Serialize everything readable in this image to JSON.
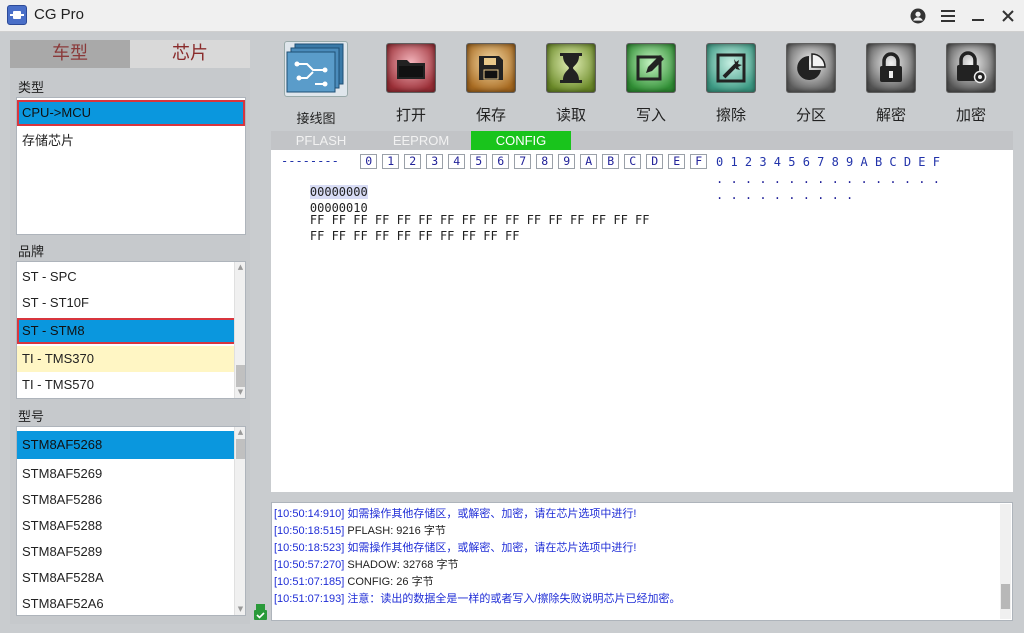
{
  "window": {
    "title": "CG Pro"
  },
  "left_panel": {
    "tabs": [
      {
        "label": "车型",
        "active": false
      },
      {
        "label": "芯片",
        "active": true
      }
    ],
    "type_section": {
      "label": "类型",
      "items": [
        {
          "label": "CPU->MCU",
          "selected": true
        },
        {
          "label": "存储芯片",
          "selected": false
        }
      ]
    },
    "brand_section": {
      "label": "品牌",
      "items": [
        {
          "label": "ST - SPC",
          "selected": false
        },
        {
          "label": "ST - ST10F",
          "selected": false
        },
        {
          "label": "ST - STM8",
          "selected": true
        },
        {
          "label": "TI - TMS370",
          "selected": false
        },
        {
          "label": "TI - TMS570",
          "selected": false
        }
      ]
    },
    "model_section": {
      "label": "型号",
      "items": [
        {
          "label": "STM8AF5268",
          "selected": true
        },
        {
          "label": "STM8AF5269",
          "selected": false
        },
        {
          "label": "STM8AF5286",
          "selected": false
        },
        {
          "label": "STM8AF5288",
          "selected": false
        },
        {
          "label": "STM8AF5289",
          "selected": false
        },
        {
          "label": "STM8AF528A",
          "selected": false
        },
        {
          "label": "STM8AF52A6",
          "selected": false
        }
      ]
    }
  },
  "toolbar": {
    "buttons": [
      {
        "label": "接线图",
        "icon": "wiring-diagram-icon",
        "color": "#3a7aa8"
      },
      {
        "label": "打开",
        "icon": "folder-icon",
        "color": "#a0353c"
      },
      {
        "label": "保存",
        "icon": "floppy-icon",
        "color": "#b87a28"
      },
      {
        "label": "读取",
        "icon": "hourglass-icon",
        "color": "#6e8a2c"
      },
      {
        "label": "写入",
        "icon": "edit-icon",
        "color": "#3d9a3b"
      },
      {
        "label": "擦除",
        "icon": "erase-icon",
        "color": "#4aa08a"
      },
      {
        "label": "分区",
        "icon": "pie-icon",
        "color": "#6a6a6a"
      },
      {
        "label": "解密",
        "icon": "unlock-icon",
        "color": "#5a5a5a"
      },
      {
        "label": "加密",
        "icon": "lock-gear-icon",
        "color": "#5a5a5a"
      }
    ]
  },
  "hex_editor": {
    "tabs": [
      {
        "label": "PFLASH",
        "active": false
      },
      {
        "label": "EEPROM",
        "active": false
      },
      {
        "label": "CONFIG",
        "active": true
      }
    ],
    "address_header": "--------",
    "columns": [
      "0",
      "1",
      "2",
      "3",
      "4",
      "5",
      "6",
      "7",
      "8",
      "9",
      "A",
      "B",
      "C",
      "D",
      "E",
      "F"
    ],
    "ascii_header": "0 1 2 3 4 5 6 7 8 9 A B C D E F",
    "rows": [
      {
        "address": "00000000",
        "bytes": "FF FF FF FF FF FF FF FF FF FF FF FF FF FF FF FF",
        "ascii": ". . . . . . . . . . . . . . . ."
      },
      {
        "address": "00000010",
        "bytes": "FF FF FF FF FF FF FF FF FF FF",
        "ascii": ". . . . . . . . . ."
      }
    ]
  },
  "log": {
    "lines": [
      {
        "time": "[10:50:14:910]",
        "text": "如需操作其他存储区，或解密、加密，请在芯片选项中进行!",
        "color": "blue"
      },
      {
        "time": "[10:50:18:515]",
        "text": "PFLASH:  9216  字节",
        "color": "black"
      },
      {
        "time": "[10:50:18:523]",
        "text": "如需操作其他存储区，或解密、加密，请在芯片选项中进行!",
        "color": "blue"
      },
      {
        "time": "[10:50:57:270]",
        "text": "SHADOW:  32768  字节",
        "color": "black"
      },
      {
        "time": "[10:51:07:185]",
        "text": "CONFIG:  26  字节",
        "color": "black"
      },
      {
        "time": "[10:51:07:193]",
        "text": "注意：读出的数据全是一样的或者写入/擦除失败说明芯片已经加密。",
        "color": "blue"
      }
    ]
  },
  "colors": {
    "selection": "#0a97de",
    "highlight_row": "#fff6c4",
    "active_tab": "#19c41c",
    "red_outline": "#d8353e",
    "log_blue": "#1f2dd6"
  }
}
